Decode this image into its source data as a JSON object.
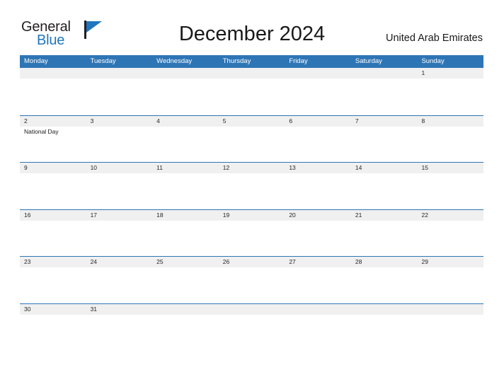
{
  "header": {
    "logo": {
      "word_one": "General",
      "word_two": "Blue"
    },
    "title": "December 2024",
    "region": "United Arab Emirates"
  },
  "calendar": {
    "weekdays": [
      "Monday",
      "Tuesday",
      "Wednesday",
      "Thursday",
      "Friday",
      "Saturday",
      "Sunday"
    ],
    "colors": {
      "header_blue": "#2e75b6",
      "daynum_band": "#f0f0f0",
      "logo_blue": "#1f76bc",
      "text": "#1a1a1a"
    },
    "weeks": [
      {
        "days": [
          {
            "num": "",
            "events": []
          },
          {
            "num": "",
            "events": []
          },
          {
            "num": "",
            "events": []
          },
          {
            "num": "",
            "events": []
          },
          {
            "num": "",
            "events": []
          },
          {
            "num": "",
            "events": []
          },
          {
            "num": "1",
            "events": []
          }
        ]
      },
      {
        "days": [
          {
            "num": "2",
            "events": [
              "National Day"
            ]
          },
          {
            "num": "3",
            "events": []
          },
          {
            "num": "4",
            "events": []
          },
          {
            "num": "5",
            "events": []
          },
          {
            "num": "6",
            "events": []
          },
          {
            "num": "7",
            "events": []
          },
          {
            "num": "8",
            "events": []
          }
        ]
      },
      {
        "days": [
          {
            "num": "9",
            "events": []
          },
          {
            "num": "10",
            "events": []
          },
          {
            "num": "11",
            "events": []
          },
          {
            "num": "12",
            "events": []
          },
          {
            "num": "13",
            "events": []
          },
          {
            "num": "14",
            "events": []
          },
          {
            "num": "15",
            "events": []
          }
        ]
      },
      {
        "days": [
          {
            "num": "16",
            "events": []
          },
          {
            "num": "17",
            "events": []
          },
          {
            "num": "18",
            "events": []
          },
          {
            "num": "19",
            "events": []
          },
          {
            "num": "20",
            "events": []
          },
          {
            "num": "21",
            "events": []
          },
          {
            "num": "22",
            "events": []
          }
        ]
      },
      {
        "days": [
          {
            "num": "23",
            "events": []
          },
          {
            "num": "24",
            "events": []
          },
          {
            "num": "25",
            "events": []
          },
          {
            "num": "26",
            "events": []
          },
          {
            "num": "27",
            "events": []
          },
          {
            "num": "28",
            "events": []
          },
          {
            "num": "29",
            "events": []
          }
        ]
      },
      {
        "days": [
          {
            "num": "30",
            "events": []
          },
          {
            "num": "31",
            "events": []
          },
          {
            "num": "",
            "events": []
          },
          {
            "num": "",
            "events": []
          },
          {
            "num": "",
            "events": []
          },
          {
            "num": "",
            "events": []
          },
          {
            "num": "",
            "events": []
          }
        ]
      }
    ]
  }
}
